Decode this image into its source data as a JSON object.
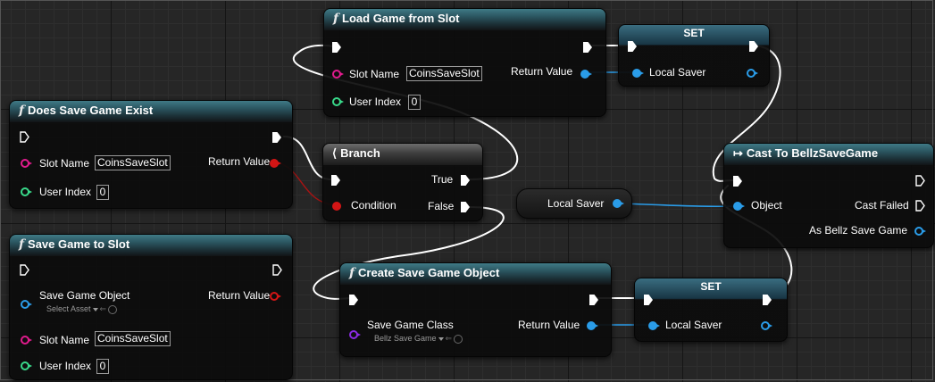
{
  "nodes": {
    "load_game": {
      "title": "Load Game from Slot",
      "slot_name_label": "Slot Name",
      "slot_name_value": "CoinsSaveSlot",
      "user_index_label": "User Index",
      "user_index_value": "0",
      "return_label": "Return Value"
    },
    "set_top": {
      "title": "SET",
      "var_label": "Local Saver"
    },
    "does_exist": {
      "title": "Does Save Game Exist",
      "slot_name_label": "Slot Name",
      "slot_name_value": "CoinsSaveSlot",
      "user_index_label": "User Index",
      "user_index_value": "0",
      "return_label": "Return Value"
    },
    "branch": {
      "title": "Branch",
      "condition_label": "Condition",
      "true_label": "True",
      "false_label": "False"
    },
    "local_saver_get": {
      "label": "Local Saver"
    },
    "cast": {
      "title": "Cast To BellzSaveGame",
      "object_label": "Object",
      "cast_failed_label": "Cast Failed",
      "as_label": "As Bellz Save Game"
    },
    "save_to_slot": {
      "title": "Save Game to Slot",
      "save_obj_label": "Save Game Object",
      "select_asset": "Select Asset",
      "return_label": "Return Value",
      "slot_name_label": "Slot Name",
      "slot_name_value": "CoinsSaveSlot",
      "user_index_label": "User Index",
      "user_index_value": "0"
    },
    "create_obj": {
      "title": "Create Save Game Object",
      "class_label": "Save Game Class",
      "class_value": "Bellz Save Game",
      "return_label": "Return Value"
    },
    "set_bottom": {
      "title": "SET",
      "var_label": "Local Saver"
    }
  },
  "icons": {
    "function": "function-icon",
    "branch": "branch-icon",
    "cast": "cast-arrow-icon"
  },
  "colors": {
    "exec": "#ffffff",
    "string_pin": "#e11b8d",
    "int_pin": "#39d98a",
    "object_pin": "#2a9ce8",
    "bool_pin": "#d31515",
    "class_pin": "#8a2be2",
    "function_header": "#2b5661"
  }
}
